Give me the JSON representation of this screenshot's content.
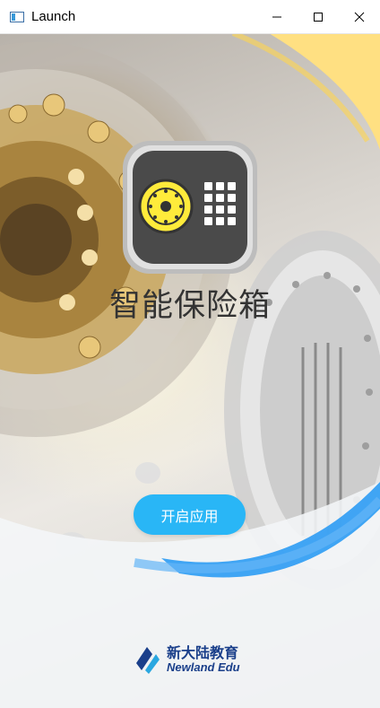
{
  "window": {
    "title": "Launch",
    "icon": "window-app-icon",
    "controls": [
      "minimize-icon",
      "maximize-icon",
      "close-icon"
    ]
  },
  "splash": {
    "app_title": "智能保险箱",
    "start_button_label": "开启应用",
    "logo_icon": "safe-icon"
  },
  "brand": {
    "name_cn": "新大陆教育",
    "name_en": "Newland Edu"
  },
  "colors": {
    "accent_yellow": "#ffe082",
    "accent_blue": "#2196f3",
    "button_blue": "#29b6f6",
    "brand_blue": "#1a3f8a",
    "safe_dark": "#4a4a4a",
    "dial_yellow": "#ffeb3b"
  }
}
